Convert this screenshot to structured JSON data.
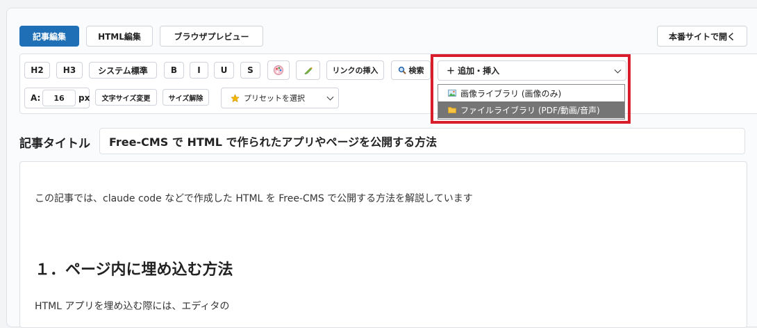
{
  "mode_tabs": {
    "article_edit": "記事編集",
    "html_edit": "HTML編集",
    "browser_preview": "ブラウザプレビュー"
  },
  "open_live_site": "本番サイトで開く",
  "toolbar": {
    "h2": "H2",
    "h3": "H3",
    "system_default": "システム標準",
    "bold": "B",
    "italic": "I",
    "underline": "U",
    "strike": "S",
    "insert_link": "リンクの挿入",
    "search": "検索",
    "add_insert": "＋ 追加・挿入",
    "font_size_label": "A:",
    "font_size_value": "16",
    "font_size_unit": "px",
    "change_font_size": "文字サイズ変更",
    "clear_size": "サイズ解除",
    "preset_select": "プリセットを選択"
  },
  "dropdown": {
    "items": [
      "画像ライブラリ (画像のみ)",
      "ファイルライブラリ (PDF/動画/音声)"
    ],
    "selected_index": 1
  },
  "article": {
    "title_label": "記事タイトル",
    "title_value": "Free-CMS で HTML で作られたアプリやページを公開する方法",
    "paragraph1": "この記事では、claude code などで作成した HTML を Free-CMS で公開する方法を解説しています",
    "heading1": "１．ページ内に埋め込む方法",
    "paragraph2": "HTML アプリを埋め込む際には、エディタの"
  },
  "colors": {
    "primary": "#1f6fb7",
    "highlight_border": "#d81e2a",
    "selected_item_bg": "#757575"
  }
}
